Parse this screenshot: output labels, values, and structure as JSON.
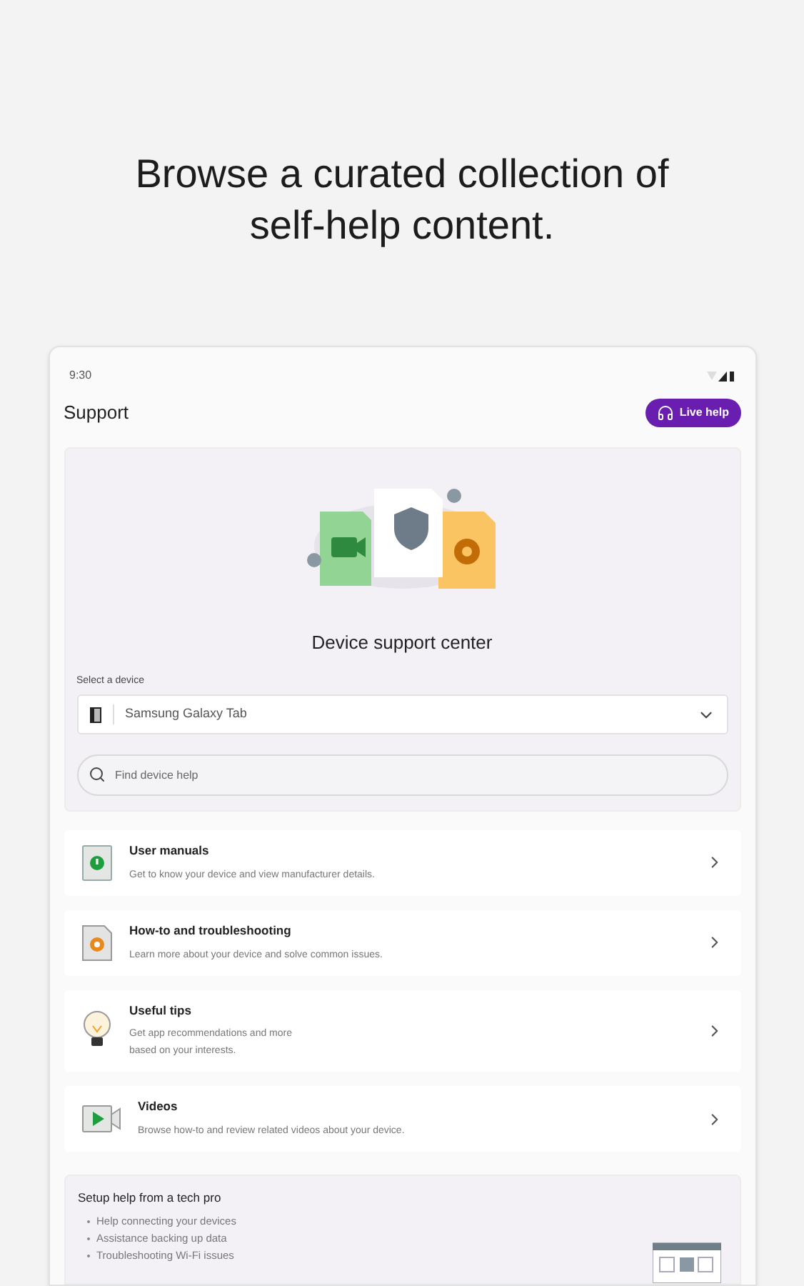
{
  "headline": "Browse a curated collection of self-help content.",
  "status_bar": {
    "time": "9:30"
  },
  "app_bar": {
    "title": "Support",
    "live_help_button": "Live help"
  },
  "hero": {
    "title": "Device support center",
    "device_label": "Select a device",
    "device_value": "Samsung Galaxy Tab",
    "search": {
      "placeholder": "Find device help"
    }
  },
  "items": [
    {
      "title": "User manuals",
      "description": "Get to know your device and view manufacturer details."
    },
    {
      "title": "How-to and troubleshooting",
      "description": "Learn more about your device and solve common issues."
    },
    {
      "title": "Useful tips",
      "description": "Get app recommendations and more\nbased on your interests."
    },
    {
      "title": "Videos",
      "description": "Browse how-to and review related videos about your device."
    }
  ],
  "tech_pro": {
    "title": "Setup help from a tech pro",
    "bullets": [
      "Help connecting your devices",
      "Assistance backing up data",
      "Troubleshooting Wi-Fi issues"
    ]
  }
}
